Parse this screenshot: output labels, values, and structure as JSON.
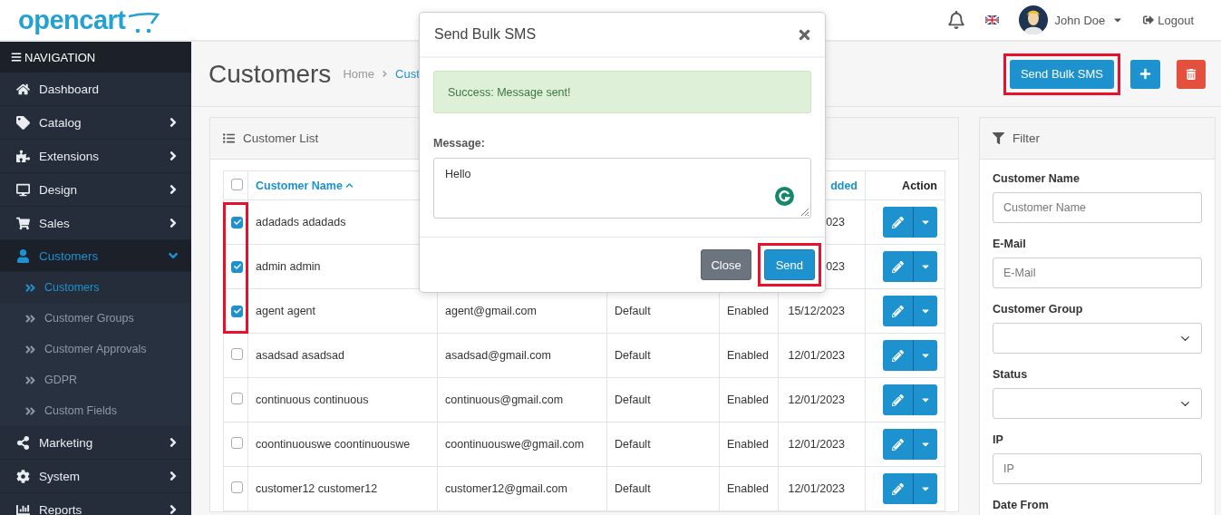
{
  "header": {
    "logo": "opencart",
    "user": "John Doe",
    "logout": "Logout"
  },
  "sidebar": {
    "title": "NAVIGATION",
    "items": [
      {
        "label": "Dashboard",
        "kind": "link",
        "selected": false
      },
      {
        "label": "Catalog",
        "kind": "menu",
        "expanded": false,
        "selected": false
      },
      {
        "label": "Extensions",
        "kind": "menu",
        "expanded": false,
        "selected": false
      },
      {
        "label": "Design",
        "kind": "menu",
        "expanded": false,
        "selected": false
      },
      {
        "label": "Sales",
        "kind": "menu",
        "expanded": false,
        "selected": false
      },
      {
        "label": "Customers",
        "kind": "menu",
        "expanded": true,
        "selected": true,
        "children": [
          {
            "label": "Customers",
            "selected": true
          },
          {
            "label": "Customer Groups",
            "selected": false
          },
          {
            "label": "Customer Approvals",
            "selected": false
          },
          {
            "label": "GDPR",
            "selected": false
          },
          {
            "label": "Custom Fields",
            "selected": false
          }
        ]
      },
      {
        "label": "Marketing",
        "kind": "menu",
        "expanded": false,
        "selected": false
      },
      {
        "label": "System",
        "kind": "menu",
        "expanded": false,
        "selected": false
      },
      {
        "label": "Reports",
        "kind": "menu",
        "expanded": false,
        "selected": false
      }
    ]
  },
  "page": {
    "title": "Customers",
    "breadcrumbs": [
      "Home",
      "Cust"
    ],
    "actions": [
      {
        "kind": "text",
        "label": "Send Bulk SMS",
        "highlighted": true
      },
      {
        "kind": "add",
        "highlighted": false
      },
      {
        "kind": "delete",
        "highlighted": false
      }
    ]
  },
  "list": {
    "title": "Customer List",
    "header": {
      "checked": false,
      "name": "Customer Name",
      "sorted": true,
      "date_added": "dded",
      "action": "Action"
    },
    "rows": [
      {
        "checked": true,
        "name": "adadads adadads",
        "date_added": "023"
      },
      {
        "checked": true,
        "name": "admin admin",
        "date_added": "023"
      },
      {
        "checked": true,
        "name": "agent agent",
        "email": "agent@gmail.com",
        "group": "Default",
        "status": "Enabled",
        "date_added": "15/12/2023"
      },
      {
        "checked": false,
        "name": "asadsad asadsad",
        "email": "asadsad@gmail.com",
        "group": "Default",
        "status": "Enabled",
        "date_added": "12/01/2023"
      },
      {
        "checked": false,
        "name": "continuous continuous",
        "email": "continuous@gmail.com",
        "group": "Default",
        "status": "Enabled",
        "date_added": "12/01/2023"
      },
      {
        "checked": false,
        "name": "coontinuouswe coontinuouswe",
        "email": "coontinuouswe@gmail.com",
        "group": "Default",
        "status": "Enabled",
        "date_added": "12/01/2023"
      },
      {
        "checked": false,
        "name": "customer12 customer12",
        "email": "customer12@gmail.com",
        "group": "Default",
        "status": "Enabled",
        "date_added": "12/01/2023"
      }
    ]
  },
  "filter": {
    "title": "Filter",
    "fields": [
      {
        "label": "Customer Name",
        "kind": "text",
        "placeholder": "Customer Name"
      },
      {
        "label": "E-Mail",
        "kind": "text",
        "placeholder": "E-Mail"
      },
      {
        "label": "Customer Group",
        "kind": "select"
      },
      {
        "label": "Status",
        "kind": "select"
      },
      {
        "label": "IP",
        "kind": "text",
        "placeholder": "IP"
      },
      {
        "label": "Date From",
        "kind": "hidden"
      }
    ]
  },
  "modal": {
    "title": "Send Bulk SMS",
    "alert": "Success: Message sent!",
    "message_label": "Message:",
    "message": "Hello",
    "buttons": [
      {
        "label": "Close",
        "kind": "secondary",
        "highlighted": false
      },
      {
        "label": "Send",
        "kind": "primary",
        "highlighted": true
      }
    ]
  }
}
